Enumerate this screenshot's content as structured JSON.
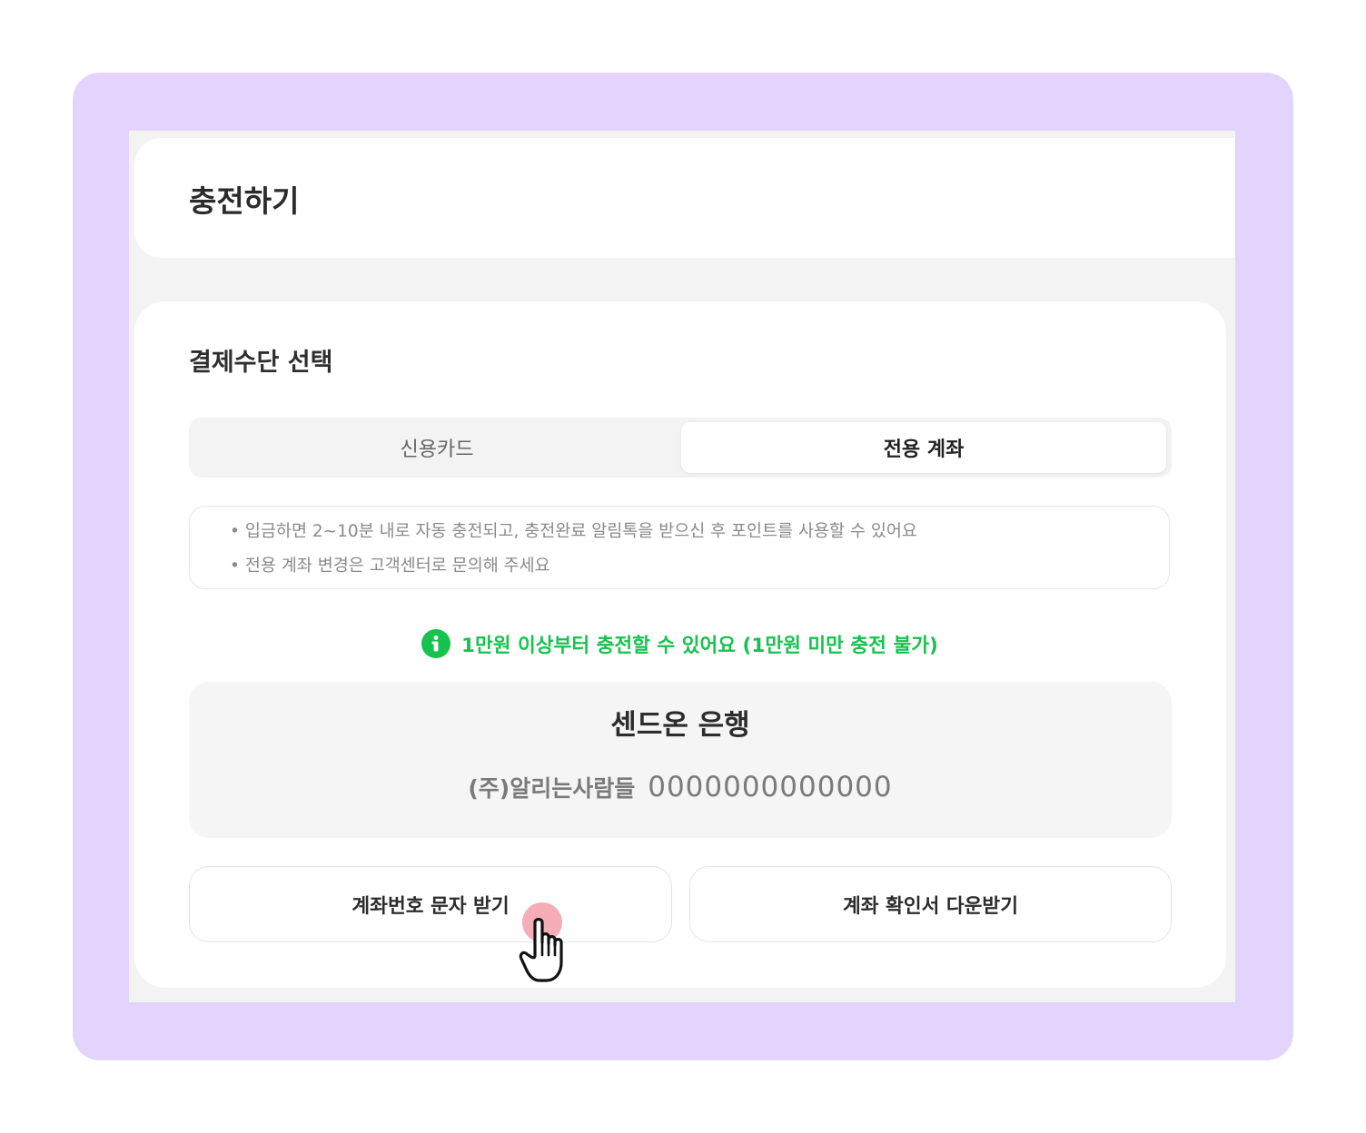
{
  "header": {
    "title": "충전하기"
  },
  "payment": {
    "section_title": "결제수단 선택",
    "tabs": [
      {
        "label": "신용카드",
        "selected": false
      },
      {
        "label": "전용 계좌",
        "selected": true
      }
    ]
  },
  "notice": {
    "bullet": "•",
    "lines": [
      "입금하면 2~10분 내로 자동 충전되고, 충전완료 알림톡을 받으신 후 포인트를 사용할 수 있어요",
      "전용 계좌 변경은 고객센터로 문의해 주세요"
    ]
  },
  "info": {
    "icon": "info-icon",
    "text": "1만원 이상부터 충전할 수 있어요 (1만원 미만 충전 불가)",
    "color": "#17c24f"
  },
  "bank": {
    "name": "센드온 은행",
    "holder": "(주)알리는사람들",
    "account_number": "0000000000000"
  },
  "buttons": {
    "sms_label": "계좌번호 문자 받기",
    "download_label": "계좌 확인서 다운받기"
  },
  "colors": {
    "frame": "#e2d4fd",
    "accent_green": "#17c24f",
    "click_indicator": "#f4a9b4"
  }
}
